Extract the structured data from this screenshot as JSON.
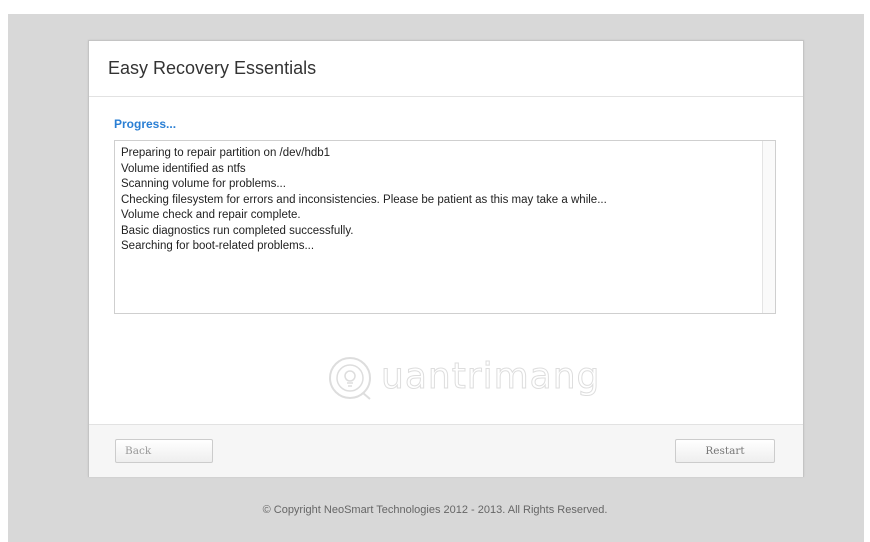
{
  "dialog": {
    "title": "Easy Recovery Essentials",
    "progress_heading": "Progress...",
    "log_lines": [
      "Preparing to repair partition on /dev/hdb1",
      "Volume identified as ntfs",
      "Scanning volume for problems...",
      "Checking filesystem for errors and inconsistencies. Please be patient as this may take a while...",
      "Volume check and repair complete.",
      "Basic diagnostics run completed successfully.",
      "Searching for boot-related problems..."
    ],
    "buttons": {
      "back_label": "Back",
      "restart_label": "Restart"
    }
  },
  "watermark": {
    "text": "uantrimang",
    "icon": "quantrimang-logo-icon"
  },
  "footer": {
    "copyright": "© Copyright NeoSmart Technologies 2012 - 2013. All Rights Reserved."
  },
  "colors": {
    "accent": "#2a7fd4",
    "backdrop": "#d8d8d8",
    "panel": "#ffffff",
    "footer_bar": "#f6f6f6"
  }
}
